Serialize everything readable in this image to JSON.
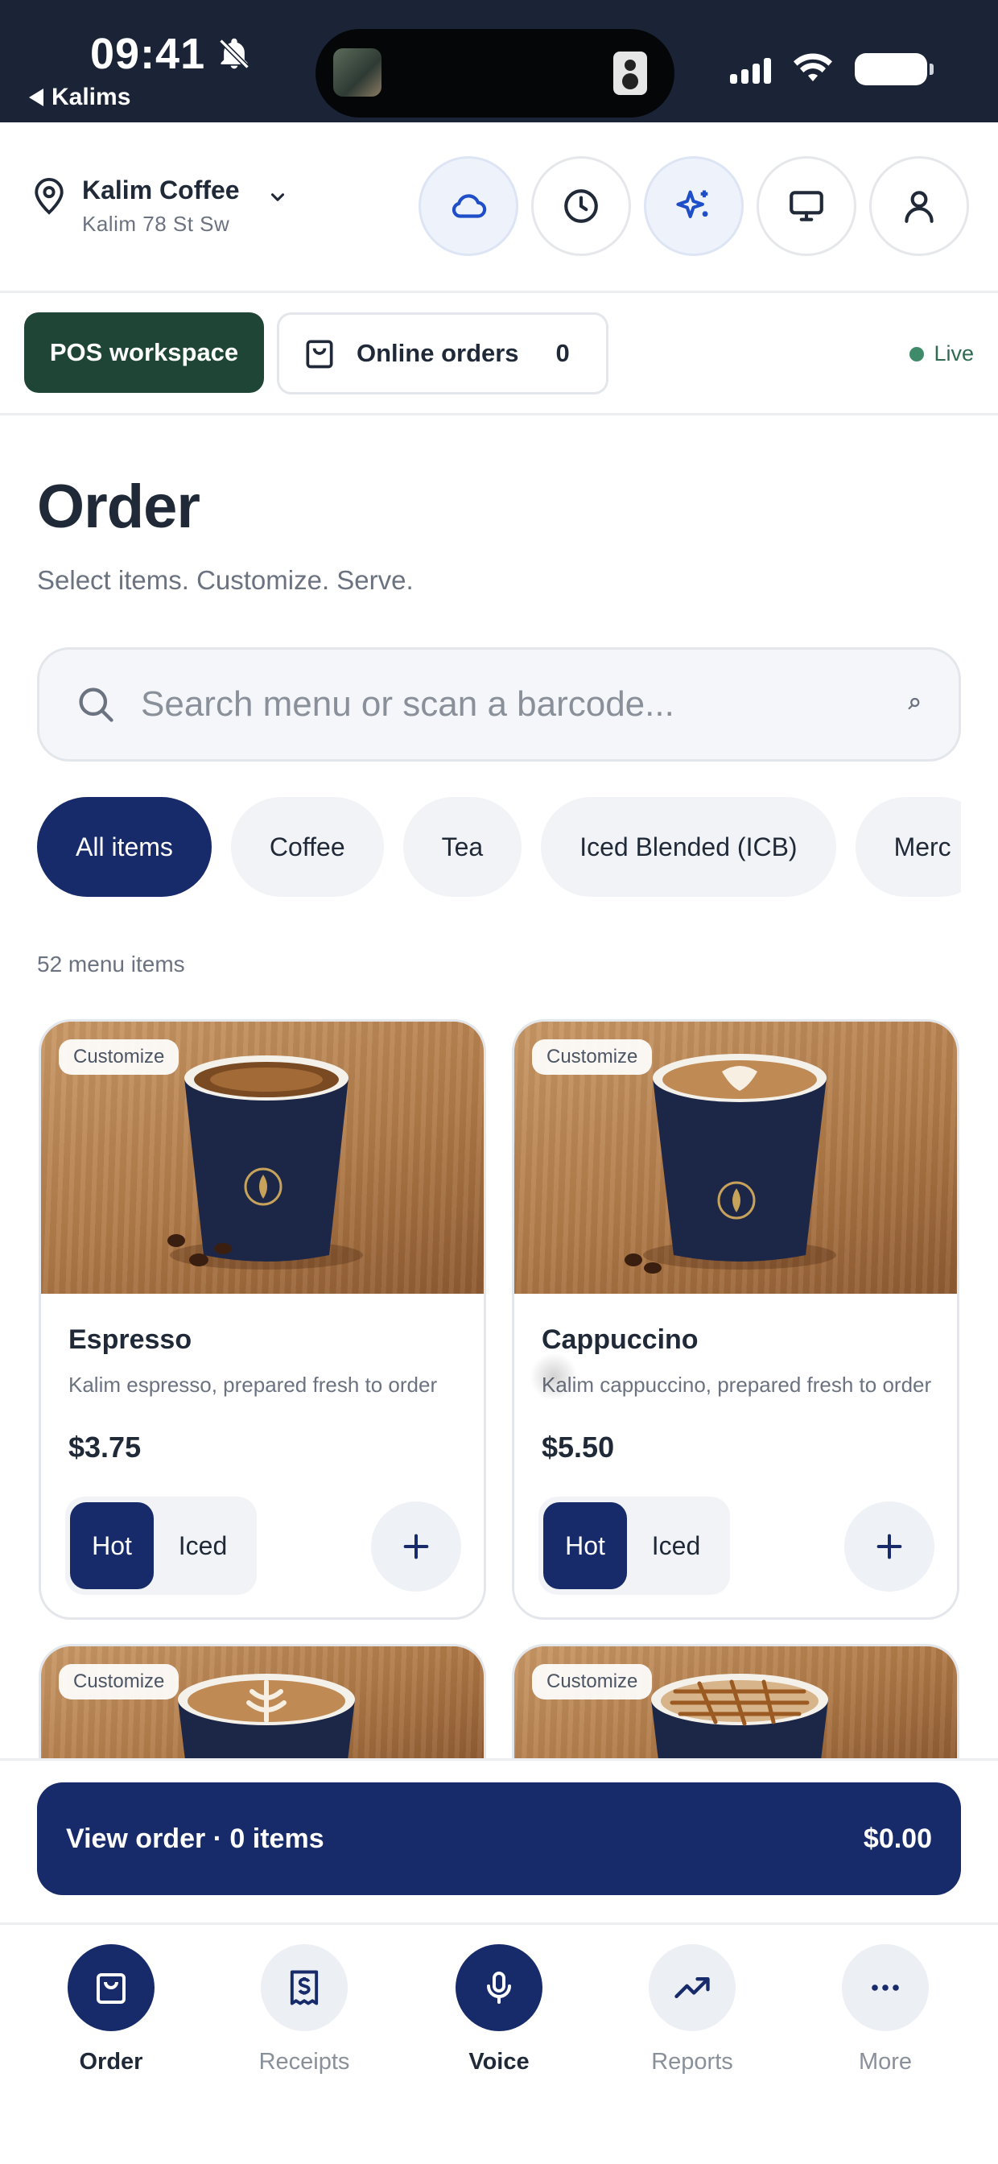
{
  "status_bar": {
    "time": "09:41",
    "back_label": "Kalims"
  },
  "location": {
    "name": "Kalim Coffee",
    "address": "Kalim 78 St Sw"
  },
  "header_buttons": [
    "cloud-icon",
    "clock-icon",
    "sparkles-icon",
    "monitor-icon",
    "user-icon"
  ],
  "workspace": {
    "pos_label": "POS workspace",
    "online_label": "Online orders",
    "online_count": "0",
    "status": "Live"
  },
  "order": {
    "title": "Order",
    "subtitle": "Select items. Customize. Serve.",
    "search_placeholder": "Search menu or scan a barcode...",
    "menu_count": "52 menu items"
  },
  "categories": [
    {
      "label": "All items",
      "active": true
    },
    {
      "label": "Coffee"
    },
    {
      "label": "Tea"
    },
    {
      "label": "Iced Blended (ICB)"
    },
    {
      "label": "Merc"
    }
  ],
  "products": [
    {
      "badge": "Customize",
      "name": "Espresso",
      "description": "Kalim espresso, prepared fresh to order",
      "price": "$3.75",
      "options": [
        "Hot",
        "Iced"
      ],
      "selected": "Hot"
    },
    {
      "badge": "Customize",
      "name": "Cappuccino",
      "description": "Kalim cappuccino, prepared fresh to order",
      "price": "$5.50",
      "options": [
        "Hot",
        "Iced"
      ],
      "selected": "Hot"
    },
    {
      "badge": "Customize"
    },
    {
      "badge": "Customize"
    }
  ],
  "cart": {
    "label": "View order · 0 items",
    "total": "$0.00"
  },
  "tabs": [
    {
      "label": "Order",
      "icon": "shopping-bag-icon",
      "active": true
    },
    {
      "label": "Receipts",
      "icon": "receipt-icon"
    },
    {
      "label": "Voice",
      "icon": "microphone-icon",
      "active": true
    },
    {
      "label": "Reports",
      "icon": "trending-up-icon"
    },
    {
      "label": "More",
      "icon": "more-icon"
    }
  ],
  "colors": {
    "primary": "#172b6a",
    "pos_green": "#1f4537",
    "live_green": "#3f8a68",
    "status_bar": "#1b2437"
  }
}
